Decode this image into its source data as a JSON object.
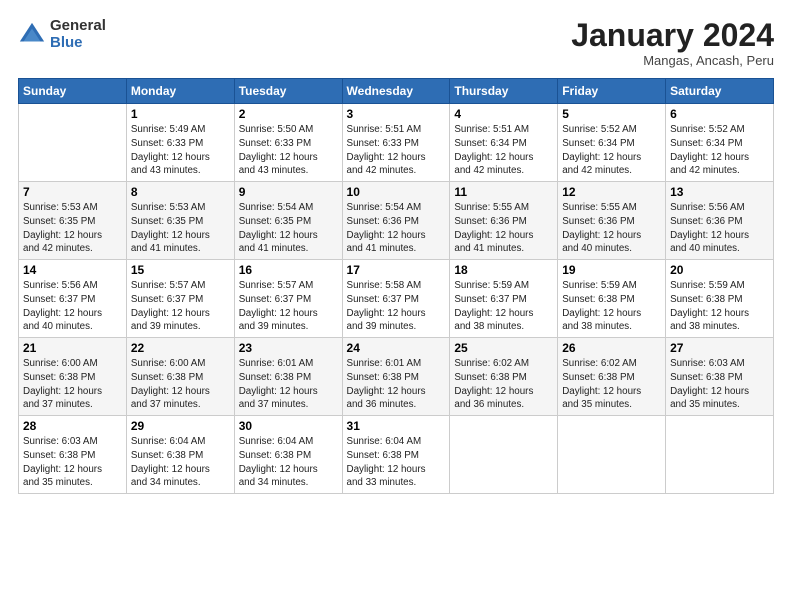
{
  "logo": {
    "general": "General",
    "blue": "Blue"
  },
  "title": "January 2024",
  "subtitle": "Mangas, Ancash, Peru",
  "days_header": [
    "Sunday",
    "Monday",
    "Tuesday",
    "Wednesday",
    "Thursday",
    "Friday",
    "Saturday"
  ],
  "weeks": [
    [
      {
        "day": "",
        "info": ""
      },
      {
        "day": "1",
        "info": "Sunrise: 5:49 AM\nSunset: 6:33 PM\nDaylight: 12 hours\nand 43 minutes."
      },
      {
        "day": "2",
        "info": "Sunrise: 5:50 AM\nSunset: 6:33 PM\nDaylight: 12 hours\nand 43 minutes."
      },
      {
        "day": "3",
        "info": "Sunrise: 5:51 AM\nSunset: 6:33 PM\nDaylight: 12 hours\nand 42 minutes."
      },
      {
        "day": "4",
        "info": "Sunrise: 5:51 AM\nSunset: 6:34 PM\nDaylight: 12 hours\nand 42 minutes."
      },
      {
        "day": "5",
        "info": "Sunrise: 5:52 AM\nSunset: 6:34 PM\nDaylight: 12 hours\nand 42 minutes."
      },
      {
        "day": "6",
        "info": "Sunrise: 5:52 AM\nSunset: 6:34 PM\nDaylight: 12 hours\nand 42 minutes."
      }
    ],
    [
      {
        "day": "7",
        "info": "Sunrise: 5:53 AM\nSunset: 6:35 PM\nDaylight: 12 hours\nand 42 minutes."
      },
      {
        "day": "8",
        "info": "Sunrise: 5:53 AM\nSunset: 6:35 PM\nDaylight: 12 hours\nand 41 minutes."
      },
      {
        "day": "9",
        "info": "Sunrise: 5:54 AM\nSunset: 6:35 PM\nDaylight: 12 hours\nand 41 minutes."
      },
      {
        "day": "10",
        "info": "Sunrise: 5:54 AM\nSunset: 6:36 PM\nDaylight: 12 hours\nand 41 minutes."
      },
      {
        "day": "11",
        "info": "Sunrise: 5:55 AM\nSunset: 6:36 PM\nDaylight: 12 hours\nand 41 minutes."
      },
      {
        "day": "12",
        "info": "Sunrise: 5:55 AM\nSunset: 6:36 PM\nDaylight: 12 hours\nand 40 minutes."
      },
      {
        "day": "13",
        "info": "Sunrise: 5:56 AM\nSunset: 6:36 PM\nDaylight: 12 hours\nand 40 minutes."
      }
    ],
    [
      {
        "day": "14",
        "info": "Sunrise: 5:56 AM\nSunset: 6:37 PM\nDaylight: 12 hours\nand 40 minutes."
      },
      {
        "day": "15",
        "info": "Sunrise: 5:57 AM\nSunset: 6:37 PM\nDaylight: 12 hours\nand 39 minutes."
      },
      {
        "day": "16",
        "info": "Sunrise: 5:57 AM\nSunset: 6:37 PM\nDaylight: 12 hours\nand 39 minutes."
      },
      {
        "day": "17",
        "info": "Sunrise: 5:58 AM\nSunset: 6:37 PM\nDaylight: 12 hours\nand 39 minutes."
      },
      {
        "day": "18",
        "info": "Sunrise: 5:59 AM\nSunset: 6:37 PM\nDaylight: 12 hours\nand 38 minutes."
      },
      {
        "day": "19",
        "info": "Sunrise: 5:59 AM\nSunset: 6:38 PM\nDaylight: 12 hours\nand 38 minutes."
      },
      {
        "day": "20",
        "info": "Sunrise: 5:59 AM\nSunset: 6:38 PM\nDaylight: 12 hours\nand 38 minutes."
      }
    ],
    [
      {
        "day": "21",
        "info": "Sunrise: 6:00 AM\nSunset: 6:38 PM\nDaylight: 12 hours\nand 37 minutes."
      },
      {
        "day": "22",
        "info": "Sunrise: 6:00 AM\nSunset: 6:38 PM\nDaylight: 12 hours\nand 37 minutes."
      },
      {
        "day": "23",
        "info": "Sunrise: 6:01 AM\nSunset: 6:38 PM\nDaylight: 12 hours\nand 37 minutes."
      },
      {
        "day": "24",
        "info": "Sunrise: 6:01 AM\nSunset: 6:38 PM\nDaylight: 12 hours\nand 36 minutes."
      },
      {
        "day": "25",
        "info": "Sunrise: 6:02 AM\nSunset: 6:38 PM\nDaylight: 12 hours\nand 36 minutes."
      },
      {
        "day": "26",
        "info": "Sunrise: 6:02 AM\nSunset: 6:38 PM\nDaylight: 12 hours\nand 35 minutes."
      },
      {
        "day": "27",
        "info": "Sunrise: 6:03 AM\nSunset: 6:38 PM\nDaylight: 12 hours\nand 35 minutes."
      }
    ],
    [
      {
        "day": "28",
        "info": "Sunrise: 6:03 AM\nSunset: 6:38 PM\nDaylight: 12 hours\nand 35 minutes."
      },
      {
        "day": "29",
        "info": "Sunrise: 6:04 AM\nSunset: 6:38 PM\nDaylight: 12 hours\nand 34 minutes."
      },
      {
        "day": "30",
        "info": "Sunrise: 6:04 AM\nSunset: 6:38 PM\nDaylight: 12 hours\nand 34 minutes."
      },
      {
        "day": "31",
        "info": "Sunrise: 6:04 AM\nSunset: 6:38 PM\nDaylight: 12 hours\nand 33 minutes."
      },
      {
        "day": "",
        "info": ""
      },
      {
        "day": "",
        "info": ""
      },
      {
        "day": "",
        "info": ""
      }
    ]
  ]
}
